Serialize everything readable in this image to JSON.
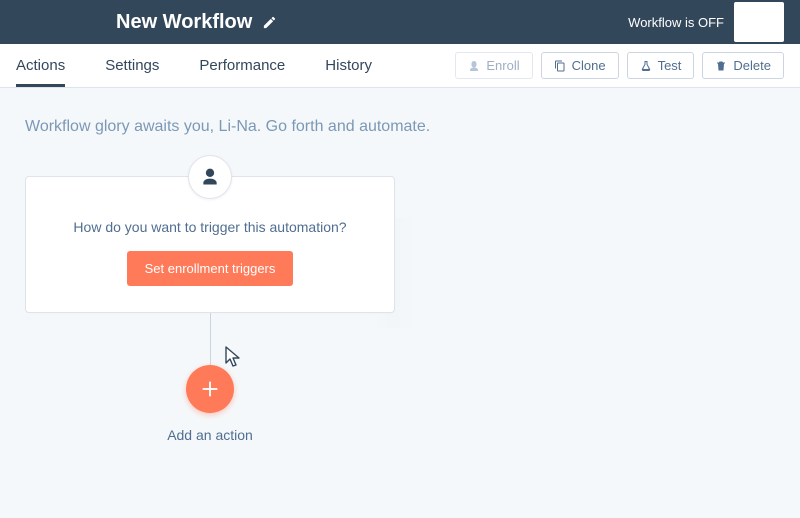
{
  "topbar": {
    "title": "New Workflow",
    "status_label": "Workflow is OFF"
  },
  "tabs": {
    "items": [
      {
        "label": "Actions",
        "active": true
      },
      {
        "label": "Settings",
        "active": false
      },
      {
        "label": "Performance",
        "active": false
      },
      {
        "label": "History",
        "active": false
      }
    ]
  },
  "toolbar": {
    "enroll_label": "Enroll",
    "clone_label": "Clone",
    "test_label": "Test",
    "delete_label": "Delete"
  },
  "canvas": {
    "intro_text": "Workflow glory awaits you, Li-Na. Go forth and automate.",
    "trigger_card": {
      "question": "How do you want to trigger this automation?",
      "button_label": "Set enrollment triggers"
    },
    "add_action_label": "Add an action"
  },
  "colors": {
    "primary": "#ff7a59",
    "navy": "#33475b",
    "mutedText": "#7c98b6",
    "border": "#cbd6e2"
  }
}
